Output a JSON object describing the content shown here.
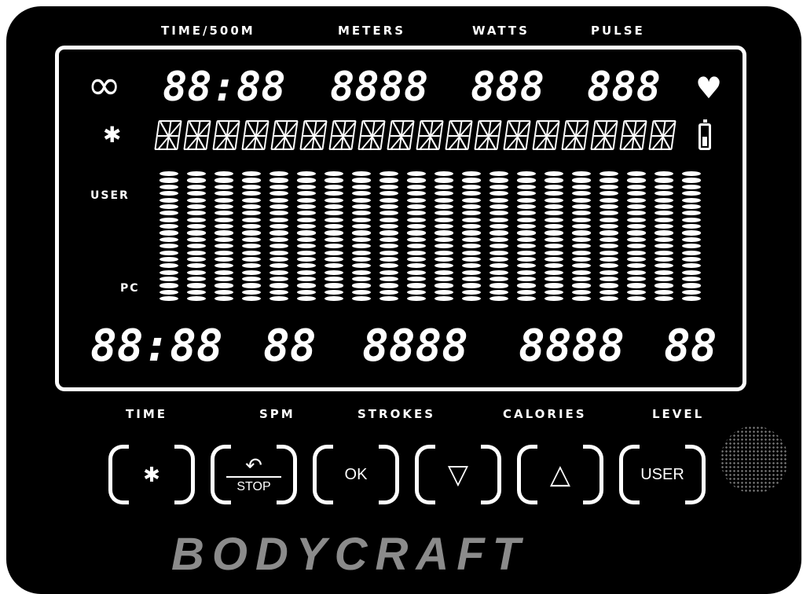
{
  "top_labels": {
    "time500m": "TIME/500M",
    "meters": "METERS",
    "watts": "WATTS",
    "pulse": "PULSE"
  },
  "screen": {
    "top_row": {
      "time500m": "88:88",
      "meters": "8888",
      "watts": "888",
      "pulse": "888"
    },
    "side_labels": {
      "user": "USER",
      "pc": "PC"
    },
    "bottom_row": {
      "time": "88:88",
      "spm": "88",
      "strokes": "8888",
      "calories": "8888",
      "level": "88"
    },
    "icons": {
      "infinity": "∞",
      "bluetooth": "✱",
      "heart": "♥",
      "battery": "battery-icon"
    }
  },
  "bottom_labels": {
    "time": "TIME",
    "spm": "SPM",
    "strokes": "STROKES",
    "calories": "CALORIES",
    "level": "LEVEL"
  },
  "buttons": {
    "bluetooth": "✱",
    "stop_arrow": "↶",
    "stop": "STOP",
    "ok": "OK",
    "down": "▽",
    "up": "△",
    "user": "USER"
  },
  "brand": "BODYCRAFT"
}
